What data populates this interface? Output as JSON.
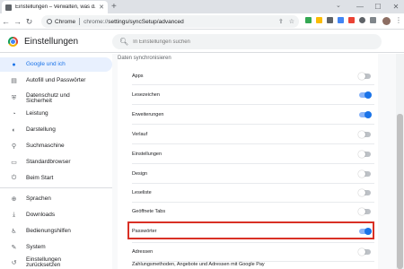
{
  "browser": {
    "tab_title": "Einstellungen – Verwalten, was d...",
    "chip_label": "Chrome",
    "url_prefix": "chrome://",
    "url_path": "settings/syncSetup/advanced"
  },
  "settings": {
    "title": "Einstellungen",
    "search_placeholder": "In Einstellungen suchen"
  },
  "sidebar": {
    "items": [
      {
        "label": "Google und ich",
        "icon": "person-icon",
        "active": true
      },
      {
        "label": "Autofill und Passwörter",
        "icon": "autofill-icon"
      },
      {
        "label": "Datenschutz und Sicherheit",
        "icon": "shield-icon"
      },
      {
        "label": "Leistung",
        "icon": "speedometer-icon"
      },
      {
        "label": "Darstellung",
        "icon": "palette-icon"
      },
      {
        "label": "Suchmaschine",
        "icon": "search-icon"
      },
      {
        "label": "Standardbrowser",
        "icon": "browser-icon"
      },
      {
        "label": "Beim Start",
        "icon": "power-icon"
      },
      {
        "label": "Sprachen",
        "icon": "globe-icon"
      },
      {
        "label": "Downloads",
        "icon": "download-icon"
      },
      {
        "label": "Bedienungshilfen",
        "icon": "accessibility-icon"
      },
      {
        "label": "System",
        "icon": "wrench-icon"
      },
      {
        "label": "Einstellungen zurücksetzen",
        "icon": "reset-icon"
      }
    ]
  },
  "sync": {
    "heading": "Daten synchronisieren",
    "rows": [
      {
        "label": "Apps",
        "on": false
      },
      {
        "label": "Lesezeichen",
        "on": true
      },
      {
        "label": "Erweiterungen",
        "on": true
      },
      {
        "label": "Verlauf",
        "on": false
      },
      {
        "label": "Einstellungen",
        "on": false
      },
      {
        "label": "Design",
        "on": false
      },
      {
        "label": "Leseliste",
        "on": false
      },
      {
        "label": "Geöffnete Tabs",
        "on": false
      },
      {
        "label": "Passwörter",
        "on": true
      },
      {
        "label": "Adressen",
        "on": false
      },
      {
        "label": "Zahlungsmethoden, Angebote und Adressen mit Google Pay",
        "on": false
      }
    ]
  },
  "colors": {
    "accent": "#1a73e8",
    "highlight": "#d93025"
  }
}
